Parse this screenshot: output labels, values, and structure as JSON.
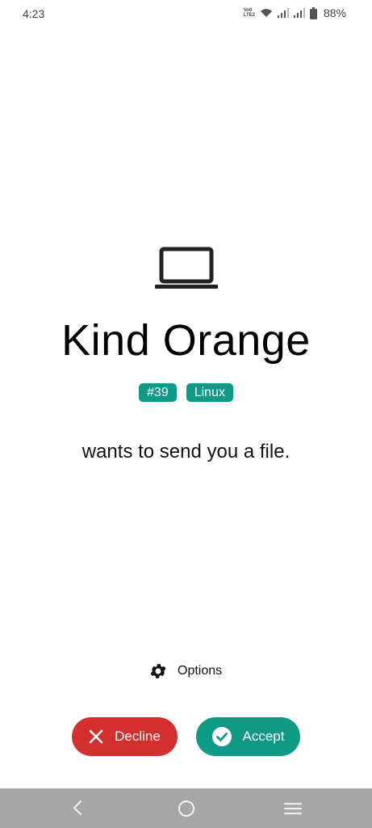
{
  "status_bar": {
    "time": "4:23",
    "volte_line1": "Vo0",
    "volte_line2": "LTE2",
    "battery": "88%"
  },
  "device": {
    "icon": "laptop-icon",
    "name": "Kind Orange",
    "badges": [
      "#39",
      "Linux"
    ]
  },
  "message": "wants to send you a file.",
  "options": {
    "icon": "gear-icon",
    "label": "Options"
  },
  "actions": {
    "decline": {
      "label": "Decline",
      "icon": "close-icon",
      "color": "#d32f2f"
    },
    "accept": {
      "label": "Accept",
      "icon": "check-circle-icon",
      "color": "#0f9a88"
    }
  },
  "nav_bar": {
    "back_icon": "back-icon",
    "home_icon": "home-icon",
    "menu_icon": "menu-icon",
    "background": "#a6a6a6"
  }
}
